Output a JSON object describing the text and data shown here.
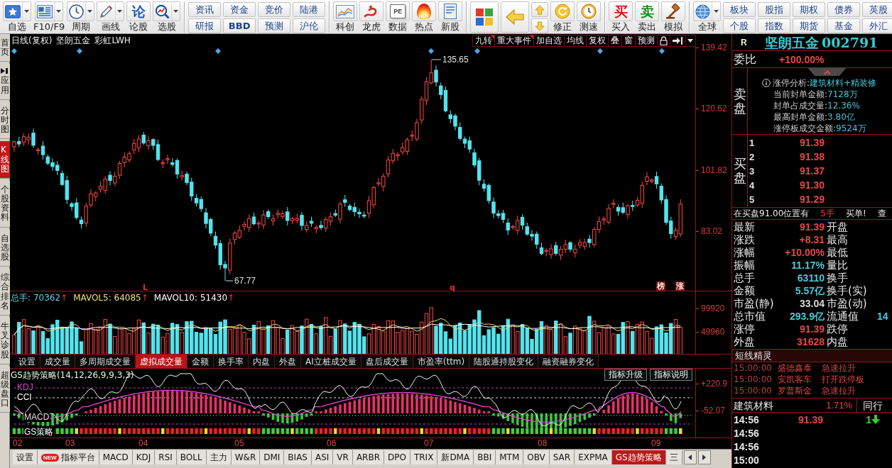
{
  "toolbar": {
    "groups": [
      {
        "items": [
          {
            "kind": "large",
            "label": "自选",
            "dropdown": true
          },
          {
            "kind": "large",
            "label": "F10/F9",
            "dropdown": true
          },
          {
            "kind": "large",
            "label": "周期",
            "dropdown": true
          },
          {
            "kind": "large",
            "label": "画线",
            "dropdown": true
          },
          {
            "kind": "large",
            "label": "论股",
            "dropdown": false,
            "glyph": "论",
            "color": "#1a5cb8"
          },
          {
            "kind": "large",
            "label": "选股",
            "dropdown": true
          }
        ]
      },
      {
        "items": [
          {
            "kind": "pair",
            "buttons": [
              {
                "label": "资讯"
              },
              {
                "label": "研报"
              }
            ]
          },
          {
            "kind": "pair",
            "buttons": [
              {
                "label": "资金"
              },
              {
                "label": "BBD",
                "bold": true
              }
            ]
          },
          {
            "kind": "pair",
            "buttons": [
              {
                "label": "竞价"
              },
              {
                "label": "预测"
              }
            ]
          },
          {
            "kind": "pair",
            "buttons": [
              {
                "label": "陆港"
              },
              {
                "label": "沪伦"
              }
            ]
          }
        ]
      },
      {
        "items": [
          {
            "kind": "large",
            "label": "科创",
            "dropdown": false
          },
          {
            "kind": "large",
            "label": "龙虎",
            "dropdown": false
          },
          {
            "kind": "large",
            "label": "数据",
            "dropdown": false,
            "glyph": "PE"
          },
          {
            "kind": "large",
            "label": "热点",
            "dropdown": false,
            "glyph": "HOT"
          },
          {
            "kind": "large",
            "label": "新股",
            "dropdown": false
          }
        ]
      },
      {
        "items": [
          {
            "kind": "tile"
          },
          {
            "kind": "tile"
          },
          {
            "kind": "stack"
          },
          {
            "kind": "large",
            "label": "修正",
            "dropdown": false
          },
          {
            "kind": "large",
            "label": "测速",
            "dropdown": false
          }
        ]
      },
      {
        "items": [
          {
            "kind": "large",
            "label": "买入",
            "dropdown": false,
            "glyph": "买",
            "color": "#d41a1a"
          },
          {
            "kind": "large",
            "label": "卖出",
            "dropdown": false,
            "glyph": "卖",
            "color": "#168a16"
          },
          {
            "kind": "large",
            "label": "模拟",
            "dropdown": false
          }
        ]
      },
      {
        "items": [
          {
            "kind": "large",
            "label": "全球",
            "dropdown": true
          },
          {
            "kind": "pair",
            "buttons": [
              {
                "label": "板块"
              },
              {
                "label": "个股"
              }
            ]
          },
          {
            "kind": "pair",
            "buttons": [
              {
                "label": "股指"
              },
              {
                "label": "指数"
              }
            ]
          },
          {
            "kind": "pair",
            "buttons": [
              {
                "label": "期权"
              },
              {
                "label": "期货"
              }
            ]
          },
          {
            "kind": "pair",
            "buttons": [
              {
                "label": "债券"
              },
              {
                "label": "基金"
              }
            ]
          },
          {
            "kind": "pair",
            "buttons": [
              {
                "label": "英股"
              },
              {
                "label": "外汇"
              }
            ]
          }
        ]
      }
    ]
  },
  "side_tabs": [
    {
      "label": "首页",
      "selected": false
    },
    {
      "label": "应用",
      "selected": false
    },
    {
      "label": "分时图",
      "selected": false
    },
    {
      "label": "K线图",
      "selected": true
    },
    {
      "label": "个股资料",
      "selected": false
    },
    {
      "label": "自选股",
      "selected": false
    },
    {
      "label": "综合排名",
      "selected": false
    },
    {
      "label": "牛叉诊股",
      "selected": false
    },
    {
      "label": "超级盘口",
      "selected": false
    }
  ],
  "chart": {
    "period": "日线(复权)",
    "stock": "坚朗五金",
    "formula": "彩虹LWH",
    "tools": [
      {
        "label": "九转",
        "marked": true
      },
      {
        "label": "重大事件",
        "marked": true
      },
      {
        "label": "加自选",
        "marked": false
      },
      {
        "label": "均线",
        "marked": false
      },
      {
        "label": "复权",
        "marked": false
      },
      {
        "label": "叠",
        "marked": false
      },
      {
        "label": "窗",
        "marked": false
      },
      {
        "label": "预测",
        "marked": false
      }
    ],
    "price_ticks": [
      "139.42",
      "120.62",
      "101.82",
      "83.02"
    ],
    "high_label": "135.65",
    "low_label": "67.77",
    "marks": [
      {
        "text": "L",
        "kind": "letter"
      },
      {
        "text": "q",
        "kind": "letter"
      },
      {
        "text": "榜",
        "kind": "tag"
      },
      {
        "text": "涨",
        "kind": "tag"
      }
    ]
  },
  "volume": {
    "legend": [
      {
        "label": "总手:",
        "value": "70362",
        "trend": "↑",
        "color": "#56d2e0"
      },
      {
        "label": "MAVOL5:",
        "value": "64085",
        "trend": "↑",
        "color": "#e8e07a"
      },
      {
        "label": "MAVOL10:",
        "value": "51430",
        "trend": "↑",
        "color": "#ffffff"
      }
    ],
    "ticks": [
      "99920",
      "49960"
    ]
  },
  "volume_tabs": [
    {
      "label": "设置",
      "selected": false
    },
    {
      "label": "成交量",
      "selected": false
    },
    {
      "label": "多周期成交量",
      "selected": false
    },
    {
      "label": "虚拟成交量",
      "selected": true
    },
    {
      "label": "金额",
      "selected": false
    },
    {
      "label": "换手率",
      "selected": false
    },
    {
      "label": "内盘",
      "selected": false
    },
    {
      "label": "外盘",
      "selected": false
    },
    {
      "label": "AI立桩成交量",
      "selected": false
    },
    {
      "label": "盘后成交量",
      "selected": false
    },
    {
      "label": "市盈率(ttm)",
      "selected": false
    },
    {
      "label": "陆股通持股变化",
      "selected": false
    },
    {
      "label": "融资融券变化",
      "selected": false
    }
  ],
  "indicator": {
    "title": "GS趋势策略(14,12,26,9,9,3,3)",
    "buttons": [
      "指标升级",
      "指标说明"
    ],
    "series": [
      {
        "name": "KDJ",
        "color": "#d050d0"
      },
      {
        "name": "CCI",
        "color": "#ffffff"
      },
      {
        "name": "MACD",
        "color": "#e0e0e0"
      },
      {
        "name": "GS策略",
        "color": "#ffffff"
      }
    ],
    "ticks": [
      "+220.9",
      "-52.07"
    ]
  },
  "dates": [
    "02",
    "03",
    "04",
    "05",
    "06",
    "07",
    "08",
    "09"
  ],
  "indicator_tabs": [
    {
      "label": "设置",
      "selected": false
    },
    {
      "label": "指标平台",
      "badge": "NEW",
      "selected": false
    },
    {
      "label": "MACD",
      "selected": false
    },
    {
      "label": "KDJ",
      "selected": false
    },
    {
      "label": "RSI",
      "selected": false
    },
    {
      "label": "BOLL",
      "selected": false
    },
    {
      "label": "主力",
      "selected": false
    },
    {
      "label": "W&R",
      "selected": false
    },
    {
      "label": "DMI",
      "selected": false
    },
    {
      "label": "BIAS",
      "selected": false
    },
    {
      "label": "ASI",
      "selected": false
    },
    {
      "label": "VR",
      "selected": false
    },
    {
      "label": "ARBR",
      "selected": false
    },
    {
      "label": "DPO",
      "selected": false
    },
    {
      "label": "TRIX",
      "selected": false
    },
    {
      "label": "新DMA",
      "selected": false
    },
    {
      "label": "BBI",
      "selected": false
    },
    {
      "label": "MTM",
      "selected": false
    },
    {
      "label": "OBV",
      "selected": false
    },
    {
      "label": "SAR",
      "selected": false
    },
    {
      "label": "EXPMA",
      "selected": false
    },
    {
      "label": "GS趋势策略",
      "selected": true
    },
    {
      "label": "三",
      "selected": false
    }
  ],
  "stock_panel": {
    "flag": "R",
    "name": "坚朗五金",
    "code": "002791",
    "order_ratio": {
      "label": "委比",
      "value": "+100.00%"
    },
    "sell": {
      "label": "卖盘",
      "analysis": [
        {
          "label": "涨停分析:",
          "value": "建筑材料+精装修"
        },
        {
          "label": "当前封单金额:",
          "value": "7128万"
        },
        {
          "label": "封单占成交量:",
          "value": "12.36%"
        },
        {
          "label": "最高封单金额:",
          "value": "3.80亿"
        },
        {
          "label": "涨停板成交金额:",
          "value": "9524万"
        }
      ]
    },
    "buy": {
      "label": "买盘",
      "levels": [
        {
          "rank": "1",
          "price": "91.39"
        },
        {
          "rank": "2",
          "price": "91.38"
        },
        {
          "rank": "3",
          "price": "91.37"
        },
        {
          "rank": "4",
          "price": "91.30"
        },
        {
          "rank": "5",
          "price": "91.29"
        }
      ]
    },
    "notice": [
      {
        "text": "在买盘91.00位置有",
        "highlight": false
      },
      {
        "text": "5手",
        "highlight": true
      },
      {
        "text": "买单!",
        "highlight": false
      },
      {
        "text": "查",
        "highlight": false
      }
    ],
    "quotes": [
      {
        "label": "最新",
        "value": "91.39",
        "color": "#e8454a",
        "label2": "开盘"
      },
      {
        "label": "涨跌",
        "value": "+8.31",
        "color": "#e8454a",
        "label2": "最高"
      },
      {
        "label": "涨幅",
        "value": "+10.00%",
        "color": "#e8454a",
        "label2": "最低"
      },
      {
        "label": "振幅",
        "value": "11.17%",
        "color": "#4cc8d8",
        "label2": "量比"
      },
      {
        "label": "总手",
        "value": "63110",
        "color": "#4cc8d8",
        "label2": "换手"
      },
      {
        "label": "金额",
        "value": "5.57亿",
        "color": "#4cc8d8",
        "label2": "换手(实)"
      },
      {
        "label": "市盈(静)",
        "value": "33.04",
        "color": "#d8d8d8",
        "label2": "市盈(动)"
      },
      {
        "label": "总市值",
        "value": "293.9亿",
        "color": "#4cc8d8",
        "label2": "流通值",
        "value2": "14"
      },
      {
        "label": "涨停",
        "value": "91.39",
        "color": "#e8454a",
        "label2": "跌停"
      },
      {
        "label": "外盘",
        "value": "31628",
        "color": "#e8454a",
        "label2": "内盘"
      }
    ],
    "alerts": {
      "title": "短线精灵",
      "rows": [
        {
          "time": "15:00:00",
          "stock": "盛德鑫泰",
          "event": "急速拉升"
        },
        {
          "time": "15:00:00",
          "stock": "安凯客车",
          "event": "打开跌停板"
        },
        {
          "time": "15:00:00",
          "stock": "罗普斯金",
          "event": "急速拉升"
        }
      ]
    },
    "sector": {
      "name": "建筑材料",
      "change": "1.71%",
      "peer_tab": "同行"
    },
    "ticks": [
      {
        "time": "14:56",
        "price": "91.39",
        "volume": "1",
        "down": true
      },
      {
        "time": "14:56"
      },
      {
        "time": "14:56"
      },
      {
        "time": "15:00"
      }
    ]
  }
}
